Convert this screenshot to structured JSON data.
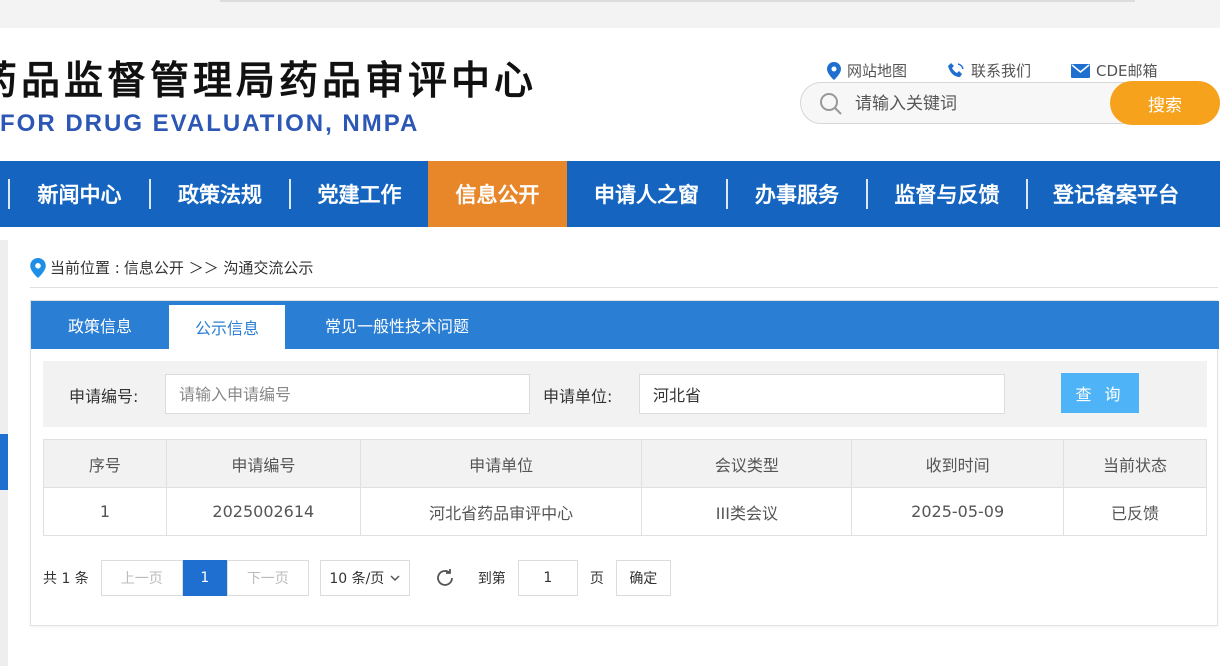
{
  "header": {
    "cn_title": "药品监督管理局药品审评中心",
    "en_title": "FOR DRUG EVALUATION, NMPA",
    "links": [
      {
        "label": "网站地图",
        "icon": "map-pin-icon"
      },
      {
        "label": "联系我们",
        "icon": "phone-icon"
      },
      {
        "label": "CDE邮箱",
        "icon": "mail-icon"
      }
    ],
    "search_placeholder": "请输入关键词",
    "search_button": "搜索"
  },
  "nav": {
    "items": [
      {
        "label": "新闻中心"
      },
      {
        "label": "政策法规"
      },
      {
        "label": "党建工作"
      },
      {
        "label": "信息公开",
        "active": true
      },
      {
        "label": "申请人之窗"
      },
      {
        "label": "办事服务"
      },
      {
        "label": "监督与反馈"
      },
      {
        "label": "登记备案平台"
      }
    ]
  },
  "breadcrumb": {
    "prefix": "当前位置 : ",
    "path": "信息公开 ＞＞ 沟通交流公示"
  },
  "tabs": [
    {
      "label": "政策信息"
    },
    {
      "label": "公示信息",
      "active": true
    },
    {
      "label": "常见一般性技术问题"
    }
  ],
  "filter": {
    "app_no_label": "申请编号:",
    "app_no_placeholder": "请输入申请编号",
    "app_unit_label": "申请单位:",
    "app_unit_value": "河北省",
    "query_button": "查 询"
  },
  "table": {
    "headers": [
      "序号",
      "申请编号",
      "申请单位",
      "会议类型",
      "收到时间",
      "当前状态"
    ],
    "rows": [
      [
        "1",
        "2025002614",
        "河北省药品审评中心",
        "III类会议",
        "2025-05-09",
        "已反馈"
      ]
    ]
  },
  "pager": {
    "total": "共 1 条",
    "prev": "上一页",
    "current": "1",
    "next": "下一页",
    "page_size": "10 条/页",
    "goto_label": "到第",
    "goto_value": "1",
    "page_unit": "页",
    "confirm": "确定"
  },
  "colors": {
    "nav_bg": "#1565c0",
    "nav_active": "#e8862a",
    "tab_bg": "#2a7fd4",
    "search_button": "#f7a21c",
    "query_button": "#4eb3f7",
    "en_title": "#2c57b5"
  }
}
